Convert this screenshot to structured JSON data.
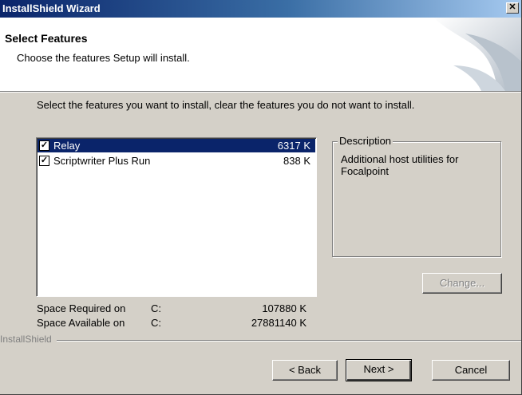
{
  "window": {
    "title": "InstallShield Wizard",
    "close_label": "✕"
  },
  "header": {
    "title": "Select Features",
    "subtitle": "Choose the features Setup will install."
  },
  "instruction": "Select the features you want to install, clear the features you do not want to install.",
  "features": [
    {
      "name": "Relay",
      "size": "6317 K",
      "checked": true,
      "selected": true
    },
    {
      "name": "Scriptwriter Plus Run",
      "size": "838 K",
      "checked": true,
      "selected": false
    }
  ],
  "description": {
    "legend": "Description",
    "text": "Additional host utilities for Focalpoint"
  },
  "space": {
    "required_label": "Space Required on",
    "required_drive": "C:",
    "required_value": "107880 K",
    "available_label": "Space Available on",
    "available_drive": "C:",
    "available_value": "27881140 K"
  },
  "branding": "InstallShield",
  "buttons": {
    "change": "Change...",
    "back": "< Back",
    "next": "Next >",
    "cancel": "Cancel"
  },
  "icons": {
    "check": "check-icon",
    "close": "close-icon"
  },
  "colors": {
    "title_start": "#0a246a",
    "title_end": "#a6caf0",
    "selection": "#0a246a",
    "face": "#d4d0c8"
  }
}
